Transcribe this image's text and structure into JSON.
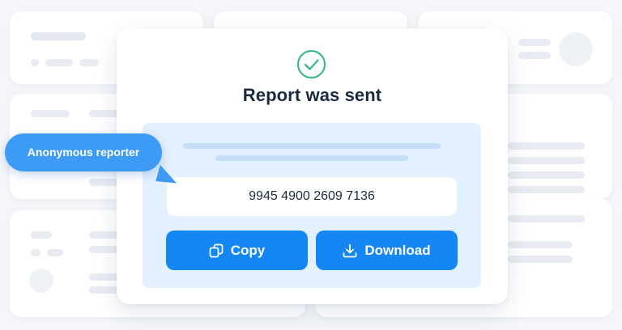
{
  "background": {
    "color": "#f4f6fa"
  },
  "modal": {
    "title": "Report was sent",
    "code": "9945 4900 2609 7136",
    "copy_label": "Copy",
    "download_label": "Download",
    "icons": {
      "status": "check-circle-icon",
      "copy": "copy-icon",
      "download": "download-icon"
    },
    "colors": {
      "success": "#3dba86",
      "primary": "#1587f5",
      "panel": "#e3f0fd",
      "text": "#1b2a3f"
    }
  },
  "badge": {
    "label": "Anonymous reporter",
    "color": "#3d9bf6"
  }
}
